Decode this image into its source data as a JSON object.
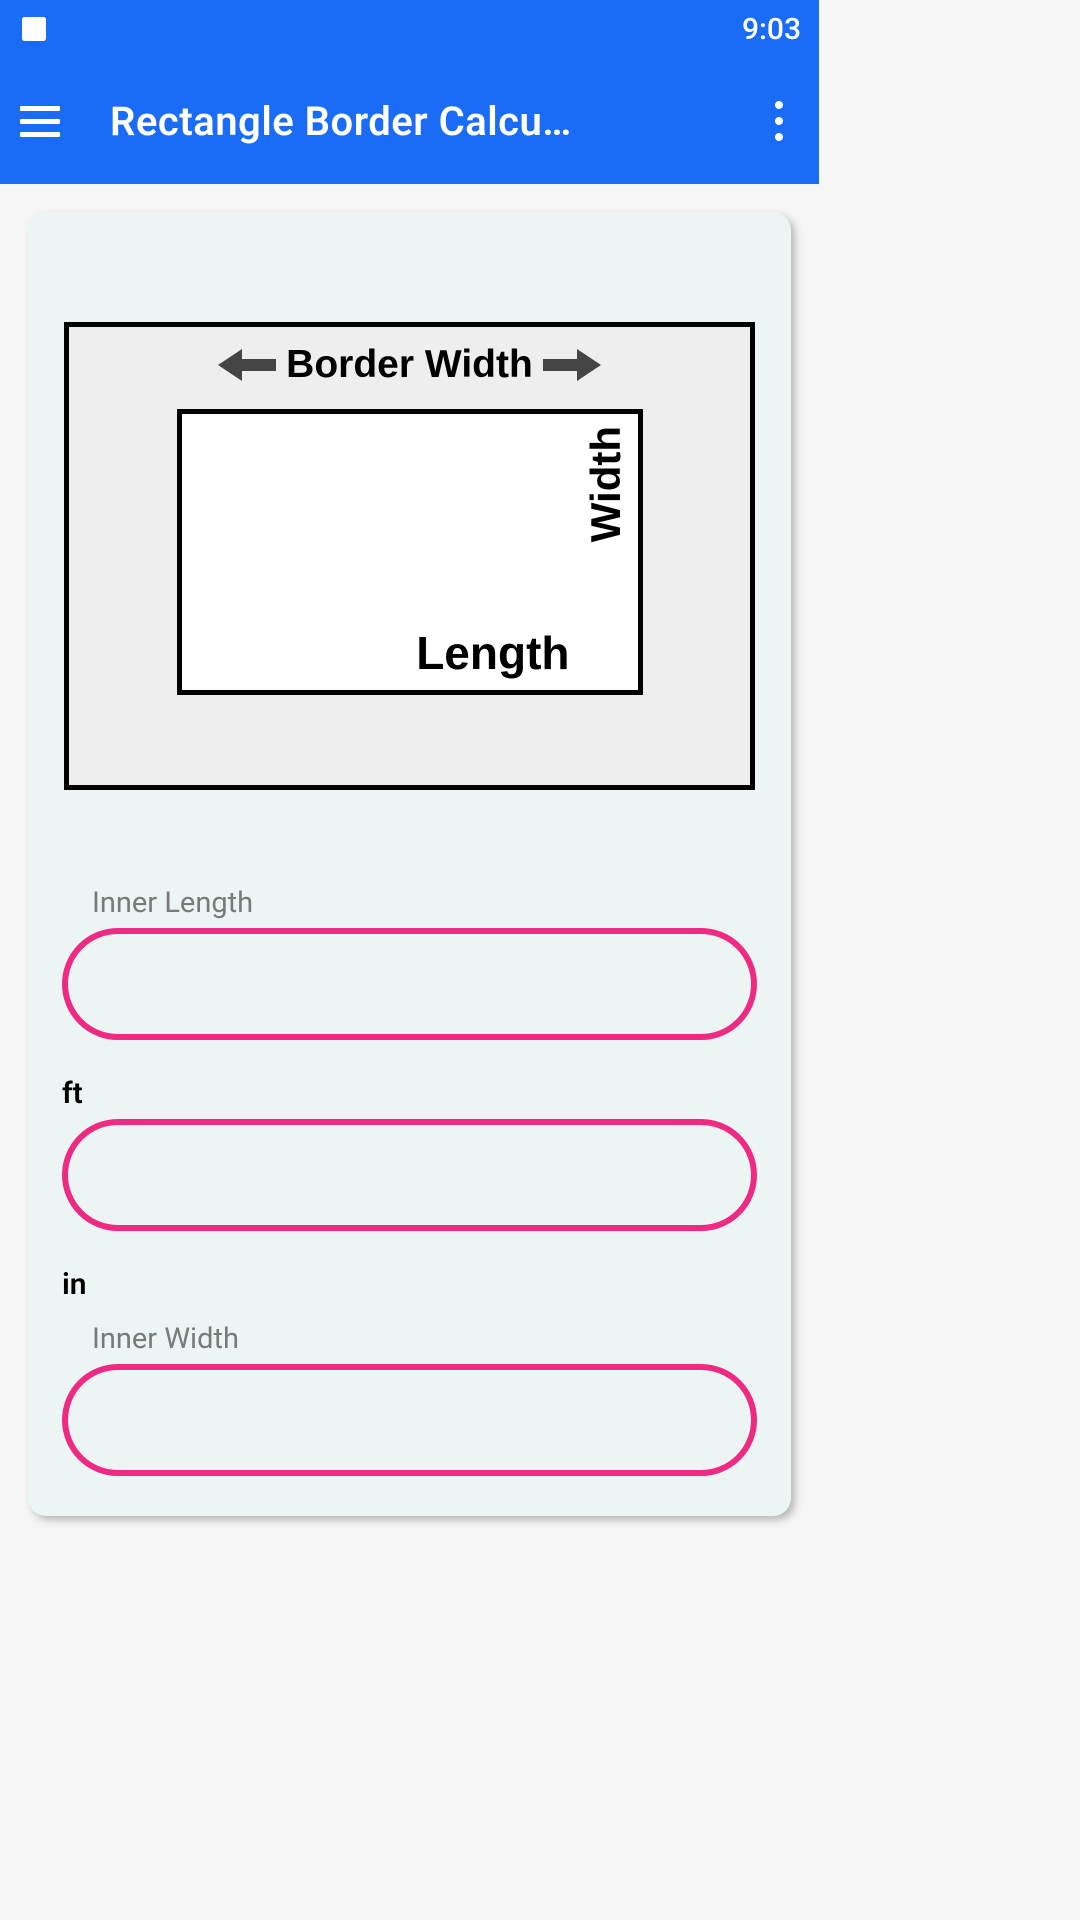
{
  "statusBar": {
    "time": "9:03"
  },
  "appBar": {
    "title": "Rectangle Border Calcu…"
  },
  "diagram": {
    "borderWidthLabel": "Border Width",
    "lengthLabel": "Length",
    "widthLabel": "Width"
  },
  "form": {
    "innerLengthLabel": "Inner Length",
    "ftLabel": "ft",
    "inLabel": "in",
    "innerWidthLabel": "Inner Width",
    "innerLengthValue": "",
    "ftValue": "",
    "inValue": ""
  }
}
